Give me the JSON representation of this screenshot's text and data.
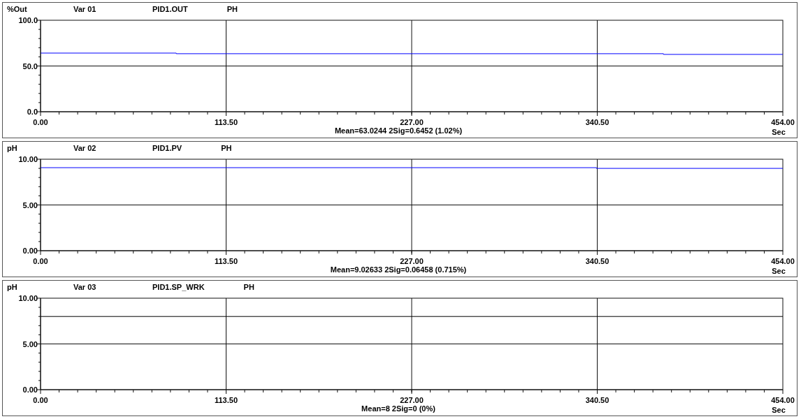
{
  "panels": [
    {
      "unit": "%Out",
      "var": "Var 01",
      "eng_unit": "PH",
      "stats": "Mean=63.0244  2Sig=0.6452  (1.02%)",
      "chart_data": {
        "type": "line",
        "grid": true,
        "xlabel": "Sec",
        "x": [
          0,
          83,
          83,
          381,
          381,
          454
        ],
        "series": [
          {
            "name": "PID1.OUT",
            "color": "#0000ff",
            "values": [
              64.1,
              64.1,
              63.4,
              63.4,
              62.7,
              62.7
            ]
          }
        ],
        "xlim": [
          0,
          454
        ],
        "ylim": [
          0,
          100
        ],
        "xticks": [
          {
            "value": 0,
            "label": "0.00"
          },
          {
            "value": 113.5,
            "label": "113.50"
          },
          {
            "value": 227,
            "label": "227.00"
          },
          {
            "value": 340.5,
            "label": "340.50"
          },
          {
            "value": 454,
            "label": "454.00"
          }
        ],
        "yticks": [
          {
            "value": 0,
            "label": "0.0"
          },
          {
            "value": 50,
            "label": "50.0"
          },
          {
            "value": 100,
            "label": "100.0"
          }
        ]
      }
    },
    {
      "unit": "pH",
      "var": "Var 02",
      "eng_unit": "PH",
      "stats": "Mean=9.02633  2Sig=0.06458  (0.715%)",
      "chart_data": {
        "type": "line",
        "grid": true,
        "xlabel": "Sec",
        "x": [
          0,
          340,
          340,
          454
        ],
        "series": [
          {
            "name": "PID1.PV",
            "color": "#0000ff",
            "values": [
              9.08,
              9.08,
              9.0,
              9.0
            ]
          }
        ],
        "xlim": [
          0,
          454
        ],
        "ylim": [
          0,
          10
        ],
        "xticks": [
          {
            "value": 0,
            "label": "0.00"
          },
          {
            "value": 113.5,
            "label": "113.50"
          },
          {
            "value": 227,
            "label": "227.00"
          },
          {
            "value": 340.5,
            "label": "340.50"
          },
          {
            "value": 454,
            "label": "454.00"
          }
        ],
        "yticks": [
          {
            "value": 0,
            "label": "0.00"
          },
          {
            "value": 5,
            "label": "5.00"
          },
          {
            "value": 10,
            "label": "10.00"
          }
        ]
      }
    },
    {
      "unit": "pH",
      "var": "Var 03",
      "eng_unit": "PH",
      "stats": "Mean=8  2Sig=0  (0%)",
      "chart_data": {
        "type": "line",
        "grid": true,
        "xlabel": "Sec",
        "x": [
          0,
          454
        ],
        "series": [
          {
            "name": "PID1.SP_WRK",
            "color": "#000000",
            "values": [
              8,
              8
            ]
          }
        ],
        "xlim": [
          0,
          454
        ],
        "ylim": [
          0,
          10
        ],
        "xticks": [
          {
            "value": 0,
            "label": "0.00"
          },
          {
            "value": 113.5,
            "label": "113.50"
          },
          {
            "value": 227,
            "label": "227.00"
          },
          {
            "value": 340.5,
            "label": "340.50"
          },
          {
            "value": 454,
            "label": "454.00"
          }
        ],
        "yticks": [
          {
            "value": 0,
            "label": "0.00"
          },
          {
            "value": 5,
            "label": "5.00"
          },
          {
            "value": 10,
            "label": "10.00"
          }
        ]
      }
    }
  ]
}
